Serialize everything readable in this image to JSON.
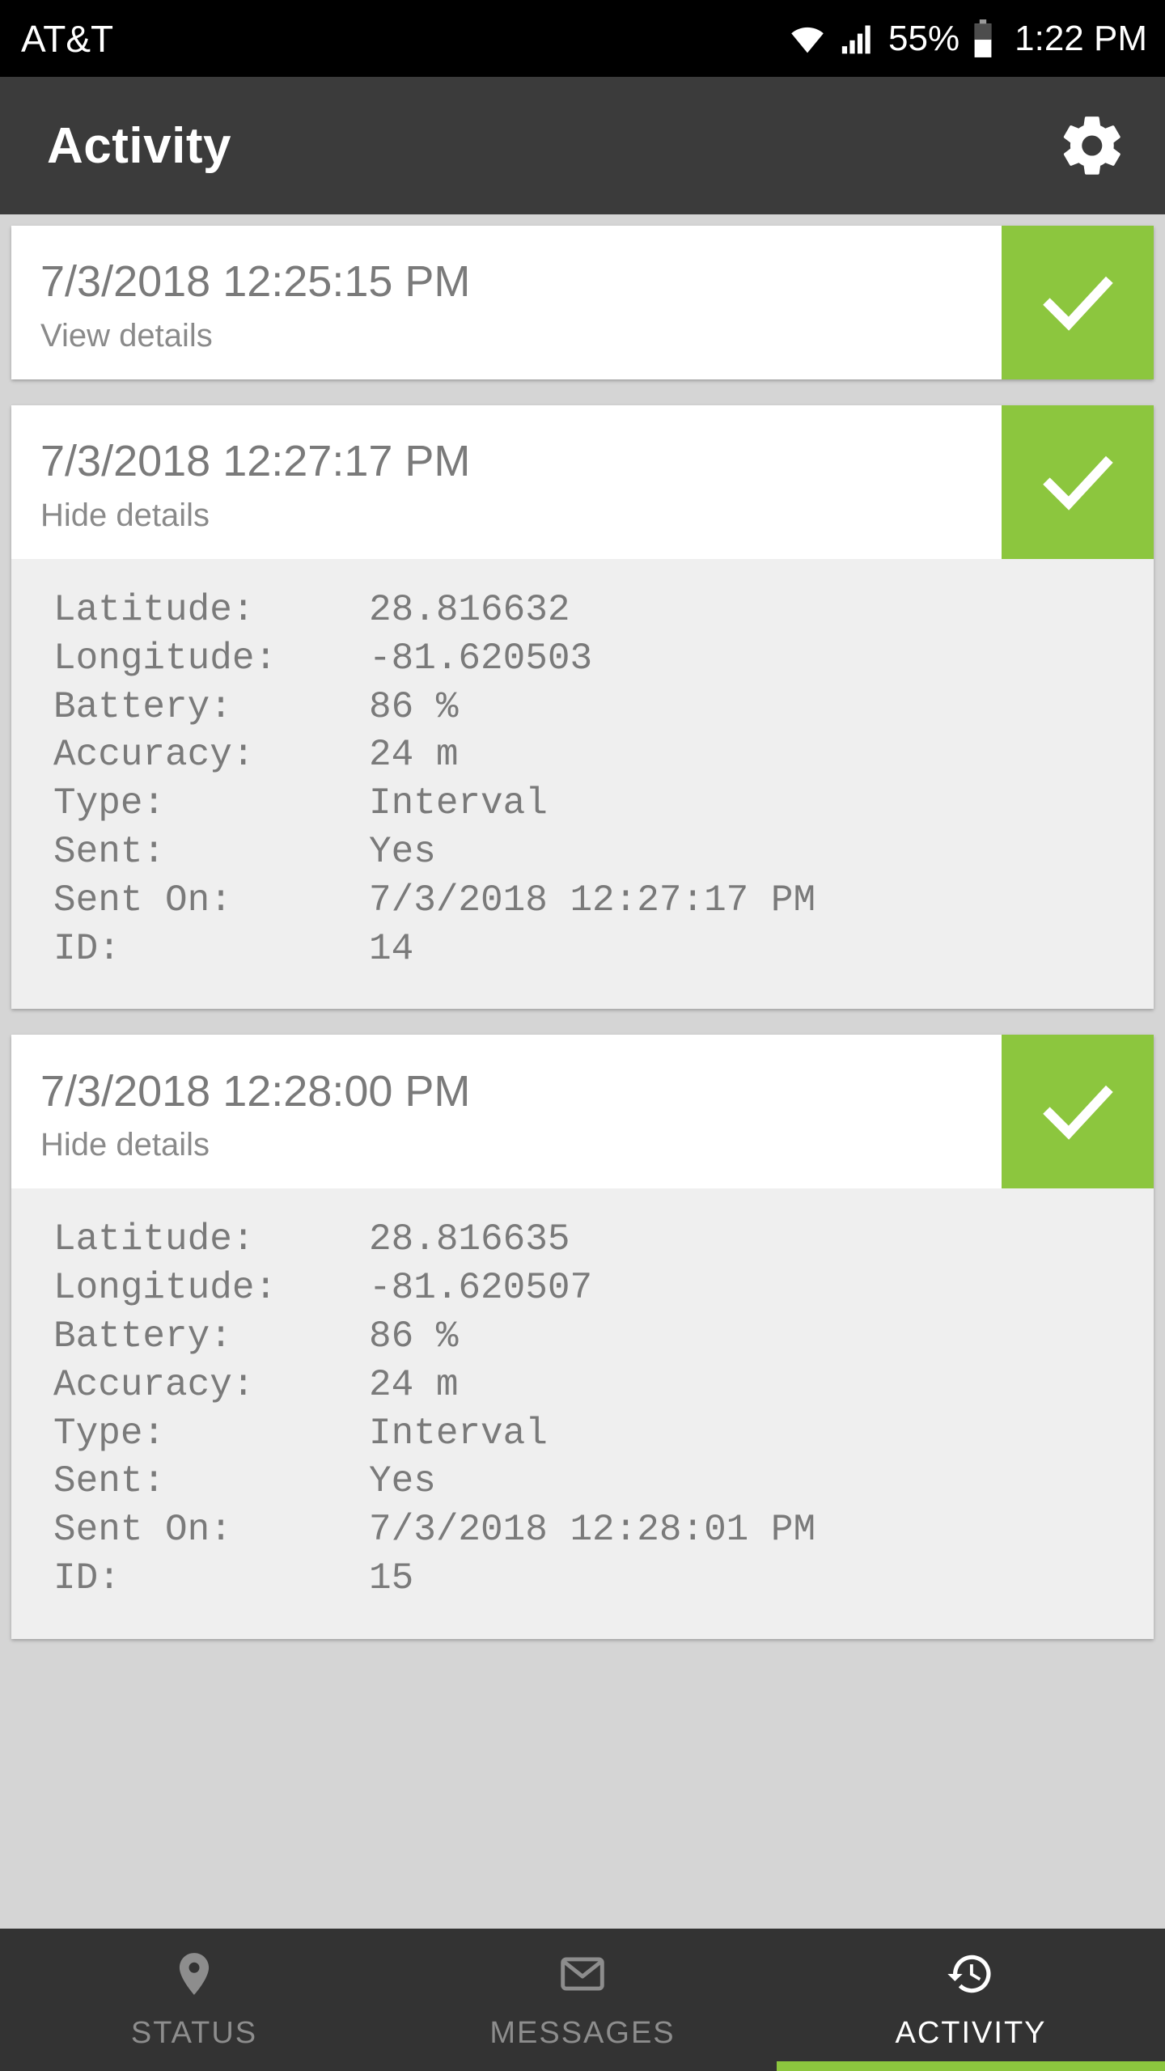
{
  "status_bar": {
    "carrier": "AT&T",
    "wifi_icon": "wifi-icon",
    "signal_icon": "cellular-signal-icon",
    "battery_percent": "55%",
    "battery_icon": "battery-icon",
    "time": "1:22 PM"
  },
  "app_bar": {
    "title": "Activity",
    "settings_icon": "gear-icon"
  },
  "colors": {
    "accent_green": "#8cc63e",
    "app_bar_bg": "#3b3b3b",
    "nav_bg": "#333333",
    "page_bg": "#d5d5d5",
    "card_bg": "#ffffff",
    "details_bg": "#efefef",
    "text_gray": "#7a7a7a"
  },
  "activity_cards": [
    {
      "timestamp": "7/3/2018 12:25:15 PM",
      "toggle_label": "View details",
      "status_icon": "check-icon",
      "expanded": false,
      "details": []
    },
    {
      "timestamp": "7/3/2018 12:27:17 PM",
      "toggle_label": "Hide details",
      "status_icon": "check-icon",
      "expanded": true,
      "details": [
        {
          "label": "Latitude:",
          "value": "28.816632"
        },
        {
          "label": "Longitude:",
          "value": "-81.620503"
        },
        {
          "label": "Battery:",
          "value": "86 %"
        },
        {
          "label": "Accuracy:",
          "value": "24 m"
        },
        {
          "label": "Type:",
          "value": "Interval"
        },
        {
          "label": "Sent:",
          "value": "Yes"
        },
        {
          "label": "Sent On:",
          "value": "7/3/2018 12:27:17 PM"
        },
        {
          "label": "ID:",
          "value": "14"
        }
      ]
    },
    {
      "timestamp": "7/3/2018 12:28:00 PM",
      "toggle_label": "Hide details",
      "status_icon": "check-icon",
      "expanded": true,
      "details": [
        {
          "label": "Latitude:",
          "value": "28.816635"
        },
        {
          "label": "Longitude:",
          "value": "-81.620507"
        },
        {
          "label": "Battery:",
          "value": "86 %"
        },
        {
          "label": "Accuracy:",
          "value": "24 m"
        },
        {
          "label": "Type:",
          "value": "Interval"
        },
        {
          "label": "Sent:",
          "value": "Yes"
        },
        {
          "label": "Sent On:",
          "value": "7/3/2018 12:28:01 PM"
        },
        {
          "label": "ID:",
          "value": "15"
        }
      ]
    }
  ],
  "bottom_nav": {
    "tabs": [
      {
        "label": "STATUS",
        "icon": "map-pin-icon",
        "active": false
      },
      {
        "label": "MESSAGES",
        "icon": "envelope-icon",
        "active": false
      },
      {
        "label": "ACTIVITY",
        "icon": "history-icon",
        "active": true
      }
    ]
  }
}
